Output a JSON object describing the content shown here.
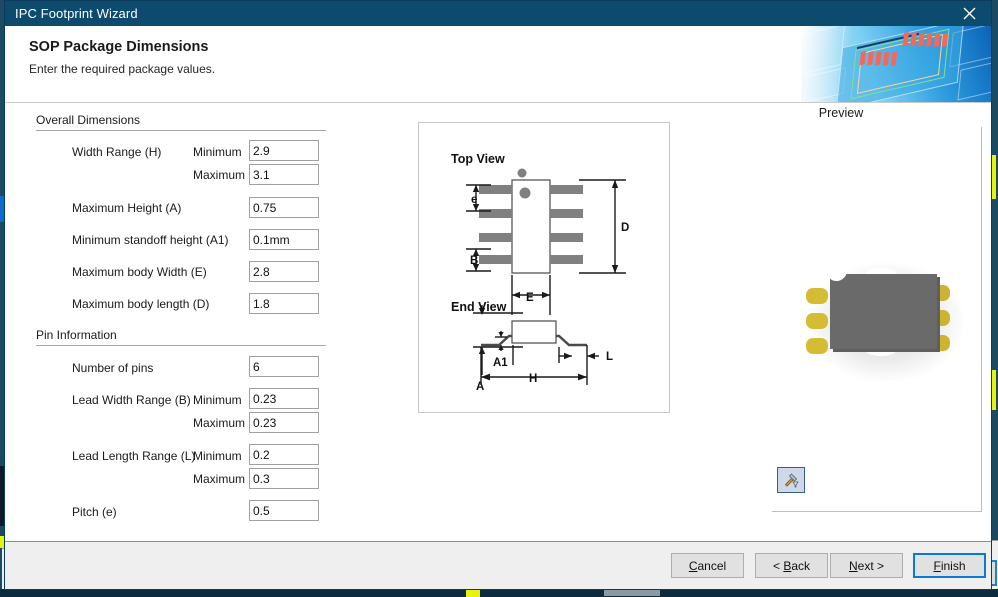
{
  "window": {
    "title": "IPC Footprint Wizard",
    "close_icon": "close-icon"
  },
  "header": {
    "title": "SOP Package Dimensions",
    "subtitle": "Enter the required package values.",
    "banner_icon": "pcb-banner-image",
    "accent_color": "#0c4a6e"
  },
  "form": {
    "groups": [
      {
        "id": "overall",
        "title": "Overall Dimensions",
        "fields": [
          {
            "label": "Width Range (H)",
            "sub": "Minimum",
            "value": "2.9"
          },
          {
            "label": "",
            "sub": "Maximum",
            "value": "3.1"
          },
          {
            "label": "Maximum Height (A)",
            "sub": "",
            "value": "0.75"
          },
          {
            "label": "Minimum standoff height (A1)",
            "sub": "",
            "value": "0.1mm"
          },
          {
            "label": "Maximum body Width (E)",
            "sub": "",
            "value": "2.8"
          },
          {
            "label": "Maximum body length (D)",
            "sub": "",
            "value": "1.8"
          }
        ]
      },
      {
        "id": "pin",
        "title": "Pin Information",
        "fields": [
          {
            "label": "Number of pins",
            "sub": "",
            "value": "6"
          },
          {
            "label": "Lead Width Range (B)",
            "sub": "Minimum",
            "value": "0.23"
          },
          {
            "label": "",
            "sub": "Maximum",
            "value": "0.23"
          },
          {
            "label": "Lead Length Range (L)",
            "sub": "Minimum",
            "value": "0.2"
          },
          {
            "label": "",
            "sub": "Maximum",
            "value": "0.3"
          },
          {
            "label": "Pitch (e)",
            "sub": "",
            "value": "0.5"
          }
        ]
      }
    ]
  },
  "diagram": {
    "top_view_label": "Top View",
    "end_view_label": "End View",
    "dimension_labels": {
      "pitch": "e",
      "lead_width": "B",
      "body_length": "D",
      "body_width": "E",
      "standoff": "A1",
      "height": "A",
      "lead_length": "L",
      "overall_width": "H"
    }
  },
  "preview": {
    "label": "Preview",
    "tool_icon": "hammer-tool-icon",
    "component": {
      "body_color": "#6a6a6a",
      "lead_color": "#d4bc34",
      "marker_color": "#ffffff",
      "lead_count": 6
    }
  },
  "footer": {
    "buttons": [
      {
        "id": "cancel",
        "label_pre": "",
        "accel": "C",
        "label_post": "ancel",
        "default": false
      },
      {
        "id": "back",
        "label_pre": "< ",
        "accel": "B",
        "label_post": "ack",
        "default": false
      },
      {
        "id": "next",
        "label_pre": "",
        "accel": "N",
        "label_post": "ext >",
        "default": false
      },
      {
        "id": "finish",
        "label_pre": "",
        "accel": "F",
        "label_post": "inish",
        "default": true
      }
    ]
  }
}
